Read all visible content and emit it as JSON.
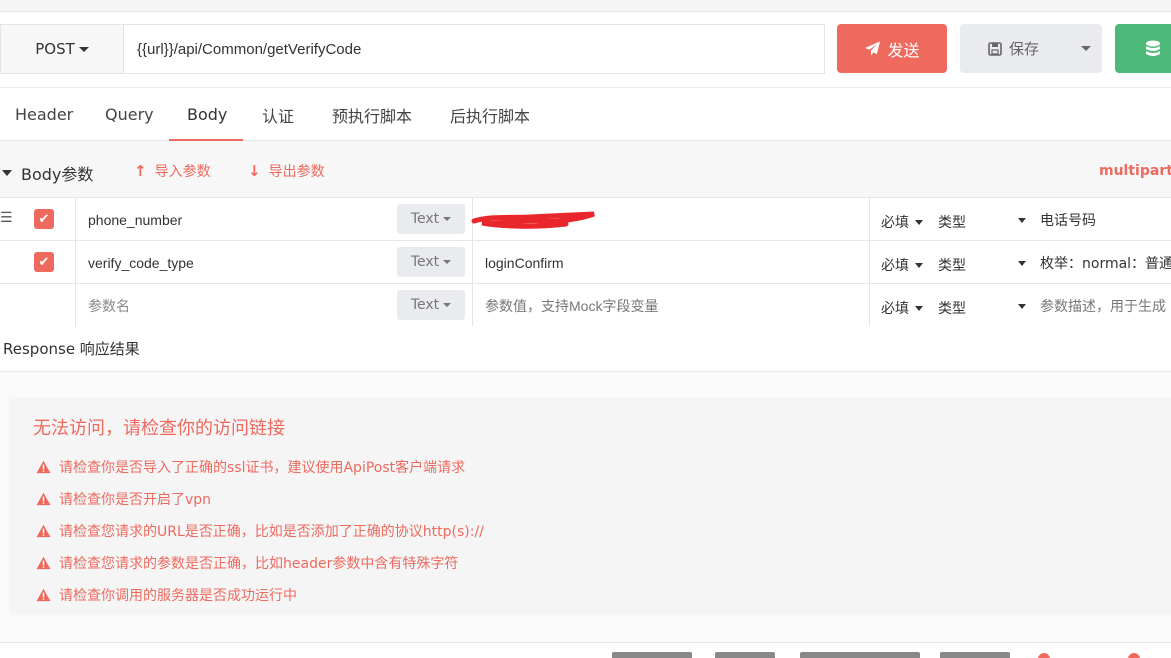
{
  "request": {
    "method": "POST",
    "url": "{{url}}/api/Common/getVerifyCode",
    "send_label": "发送",
    "save_label": "保存"
  },
  "tabs": [
    {
      "label": "Header"
    },
    {
      "label": "Query"
    },
    {
      "label": "Body"
    },
    {
      "label": "认证"
    },
    {
      "label": "预执行脚本"
    },
    {
      "label": "后执行脚本"
    }
  ],
  "active_tab": "Body",
  "body_params": {
    "section_label": "Body参数",
    "import_label": "导入参数",
    "export_label": "导出参数",
    "content_type": "multipart/f",
    "rows": [
      {
        "checked": true,
        "name": "phone_number",
        "type": "Text",
        "value": "",
        "required": "必填",
        "kind": "类型",
        "desc": "电话号码"
      },
      {
        "checked": true,
        "name": "verify_code_type",
        "type": "Text",
        "value": "loginConfirm",
        "required": "必填",
        "kind": "类型",
        "desc": "枚举：normal：普通"
      }
    ],
    "placeholder_row": {
      "name": "参数名",
      "type": "Text",
      "value": "参数值，支持Mock字段变量",
      "required": "必填",
      "kind": "类型",
      "desc": "参数描述，用于生成"
    }
  },
  "response": {
    "header": "Response 响应结果",
    "error_title": "无法访问，请检查你的访问链接",
    "error_items": [
      "请检查你是否导入了正确的ssl证书，建议使用ApiPost客户端请求",
      "请检查你是否开启了vpn",
      "请检查您请求的URL是否正确，比如是否添加了正确的协议http(s)://",
      "请检查您请求的参数是否正确，比如header参数中含有特殊字符",
      "请检查你调用的服务器是否成功运行中"
    ]
  },
  "colors": {
    "accent": "#ee6a5f",
    "save_bg": "#e9ebee",
    "db_green": "#4cb979"
  }
}
